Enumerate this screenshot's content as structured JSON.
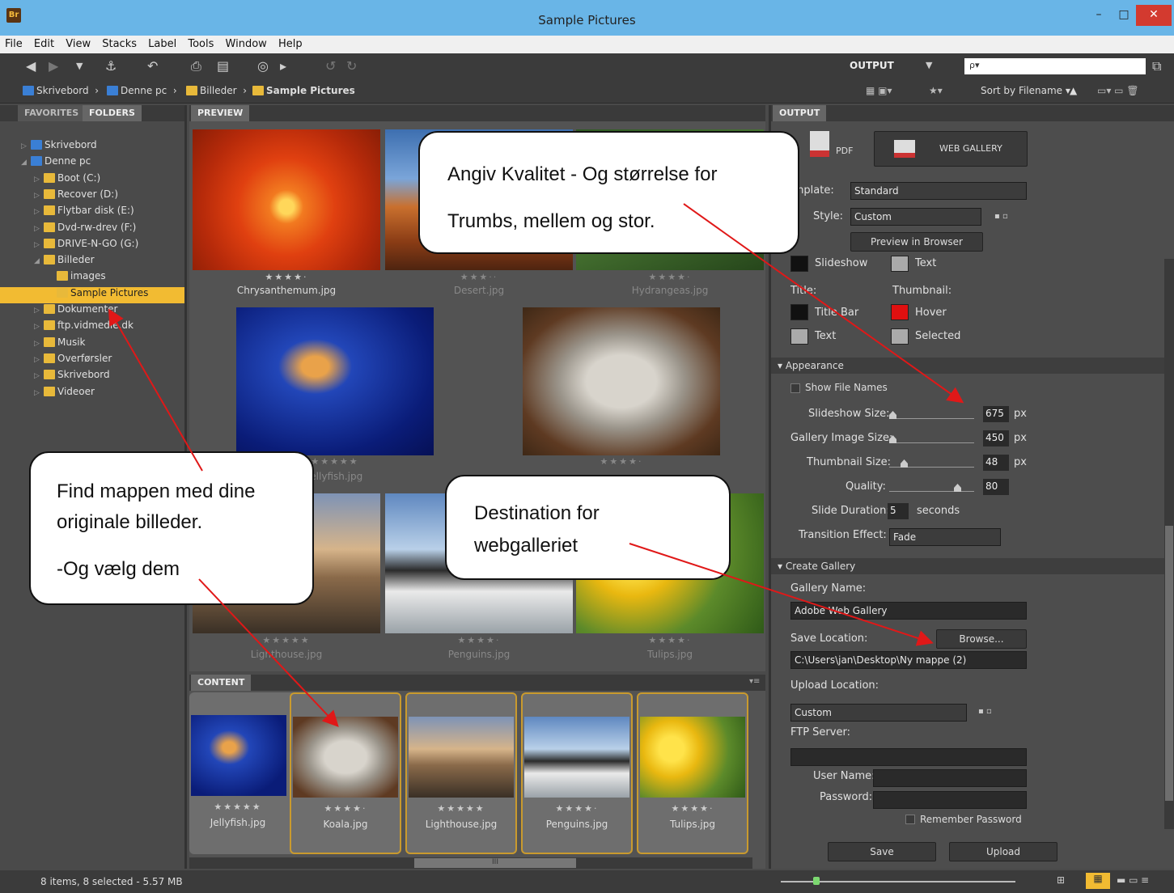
{
  "window": {
    "title": "Sample Pictures",
    "app_badge": "Br",
    "min": "–",
    "max": "□",
    "close": "✕"
  },
  "menu": [
    "File",
    "Edit",
    "View",
    "Stacks",
    "Label",
    "Tools",
    "Window",
    "Help"
  ],
  "toolbar": {
    "workspace": "OUTPUT",
    "search_placeholder": "ρ▾"
  },
  "path": [
    {
      "label": "Skrivebord"
    },
    {
      "label": "Denne pc"
    },
    {
      "label": "Billeder"
    },
    {
      "label": "Sample Pictures"
    }
  ],
  "sort": {
    "label": "Sort by Filename ▾"
  },
  "left": {
    "tabs": [
      "FAVORITES",
      "FOLDERS"
    ],
    "tree": [
      {
        "label": "Skrivebord",
        "level": 0
      },
      {
        "label": "Denne pc",
        "level": 0
      },
      {
        "label": "Boot (C:)",
        "level": 1
      },
      {
        "label": "Recover (D:)",
        "level": 1
      },
      {
        "label": "Flytbar disk (E:)",
        "level": 1
      },
      {
        "label": "Dvd-rw-drev (F:)",
        "level": 1
      },
      {
        "label": "DRIVE-N-GO (G:)",
        "level": 1
      },
      {
        "label": "Billeder",
        "level": 1
      },
      {
        "label": "images",
        "level": 2
      },
      {
        "label": "Sample Pictures",
        "level": 2
      },
      {
        "label": "Dokumenter",
        "level": 1
      },
      {
        "label": "ftp.vidmedie.dk",
        "level": 1
      },
      {
        "label": "Musik",
        "level": 1
      },
      {
        "label": "Overførsler",
        "level": 1
      },
      {
        "label": "Skrivebord",
        "level": 1
      },
      {
        "label": "Videoer",
        "level": 1
      }
    ]
  },
  "preview": {
    "tab": "PREVIEW",
    "items": [
      {
        "name": "Chrysanthemum.jpg",
        "stars": "★★★★·"
      },
      {
        "name": "Desert.jpg",
        "stars": "★★★··"
      },
      {
        "name": "Hydrangeas.jpg",
        "stars": "★★★★·"
      },
      {
        "name": "Jellyfish.jpg",
        "stars": "★★★★★"
      },
      {
        "name": "Koala.jpg",
        "stars": "★★★★·"
      },
      {
        "name": "Lighthouse.jpg",
        "stars": "★★★★★"
      },
      {
        "name": "Penguins.jpg",
        "stars": "★★★★·"
      },
      {
        "name": "Tulips.jpg",
        "stars": "★★★★·"
      }
    ]
  },
  "content": {
    "tab": "CONTENT",
    "items": [
      {
        "name": "Jellyfish.jpg",
        "stars": "★★★★★"
      },
      {
        "name": "Koala.jpg",
        "stars": "★★★★·"
      },
      {
        "name": "Lighthouse.jpg",
        "stars": "★★★★★"
      },
      {
        "name": "Penguins.jpg",
        "stars": "★★★★·"
      },
      {
        "name": "Tulips.jpg",
        "stars": "★★★★·"
      }
    ],
    "scroll": "III"
  },
  "output": {
    "tab": "OUTPUT",
    "pdf": "PDF",
    "web": "WEB GALLERY",
    "template_label": "Template:",
    "template": "Standard",
    "style_label": "Style:",
    "style": "Custom",
    "preview_btn": "Preview in Browser",
    "colors": {
      "slideshow": "Slideshow",
      "text_top": "Text",
      "title": "Title:",
      "thumbnail": "Thumbnail:",
      "title_bar": "Title Bar",
      "hover": "Hover",
      "text": "Text",
      "selected": "Selected"
    },
    "appearance": {
      "header": "Appearance",
      "show_names": "Show File Names",
      "slideshow_size": "Slideshow Size:",
      "slideshow_val": "675",
      "gallery_size": "Gallery Image Size:",
      "gallery_val": "450",
      "thumb_size": "Thumbnail Size:",
      "thumb_val": "48",
      "quality": "Quality:",
      "quality_val": "80",
      "px": "px",
      "slide_duration": "Slide Duration:",
      "duration_val": "5",
      "seconds": "seconds",
      "transition": "Transition Effect:",
      "transition_val": "Fade"
    },
    "create": {
      "header": "Create Gallery",
      "gallery_name_label": "Gallery Name:",
      "gallery_name": "Adobe Web Gallery",
      "save_label": "Save Location:",
      "browse": "Browse...",
      "save_path": "C:\\Users\\jan\\Desktop\\Ny mappe (2)",
      "upload_label": "Upload Location:",
      "upload_val": "Custom",
      "ftp_label": "FTP Server:",
      "user_label": "User Name:",
      "pass_label": "Password:",
      "remember": "Remember Password"
    },
    "save": "Save",
    "upload": "Upload"
  },
  "status": {
    "text": "8 items, 8 selected - 5.57 MB"
  },
  "callouts": {
    "quality": [
      "Angiv Kvalitet - Og størrelse for",
      "Trumbs, mellem og stor."
    ],
    "folder": [
      "Find mappen med dine",
      "originale billeder.",
      "-Og vælg dem"
    ],
    "dest": [
      "Destination for",
      "webgalleriet"
    ]
  }
}
